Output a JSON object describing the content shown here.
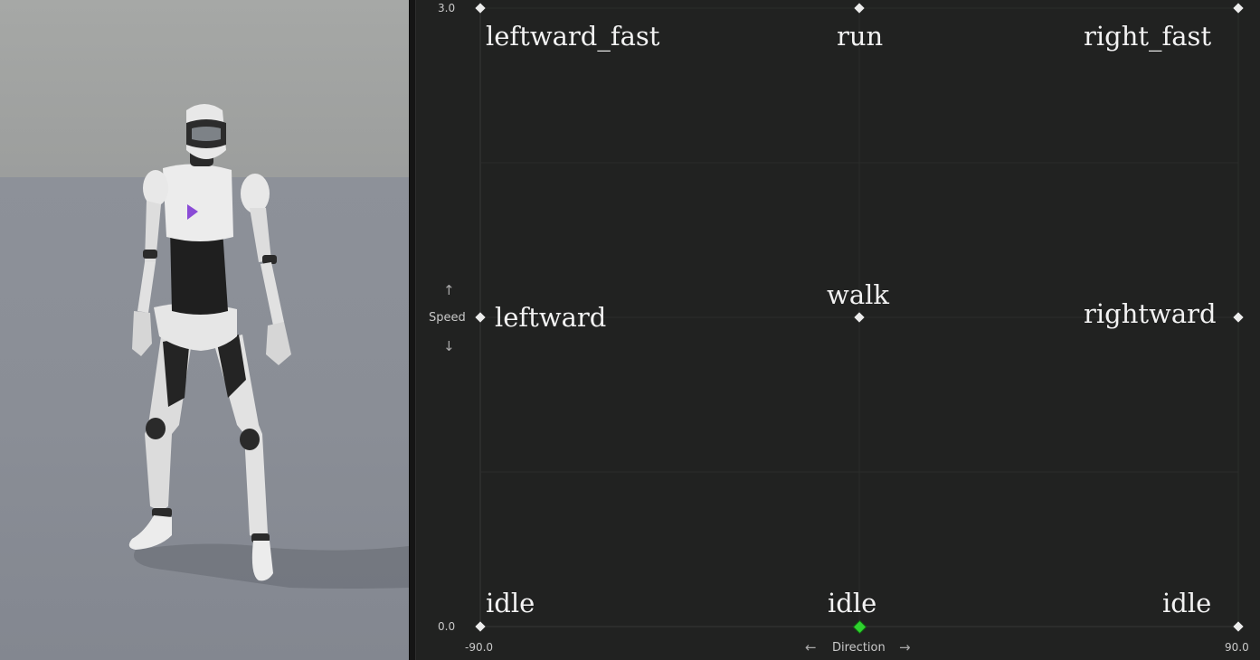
{
  "blend_space": {
    "y_axis": {
      "name": "Speed",
      "min_label": "0.0",
      "max_label": "3.0",
      "up_arrow": "↑",
      "down_arrow": "↓"
    },
    "x_axis": {
      "name": "Direction",
      "min_label": "-90.0",
      "max_label": "90.0",
      "left_arrow": "←",
      "right_arrow": "→"
    },
    "samples": {
      "leftward_fast": "leftward_fast",
      "run": "run",
      "right_fast": "right_fast",
      "leftward": "leftward",
      "walk": "walk",
      "rightward": "rightward",
      "idle_left": "idle",
      "idle_center": "idle",
      "idle_right": "idle"
    },
    "preview_point": {
      "direction": 0.0,
      "speed": 0.0
    },
    "colors": {
      "background": "#212221",
      "grid_line": "#2c2d2c",
      "sample_marker": "#ececec",
      "preview_marker": "#2fd22f"
    }
  },
  "viewport": {
    "character": "mannequin-robot",
    "logo_color": "#8a4bd6"
  }
}
